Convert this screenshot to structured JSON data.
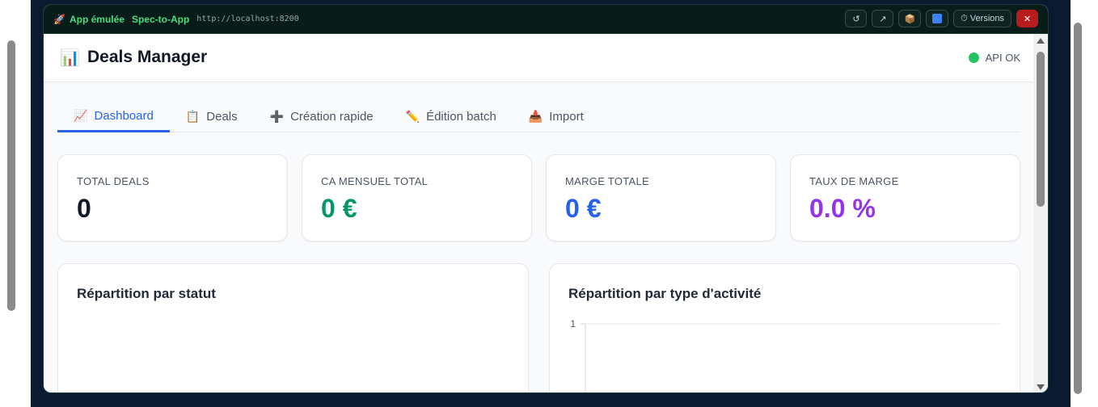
{
  "titlebar": {
    "rocket_icon": "rocket-icon",
    "app_label": "App émulée",
    "spec_label": "Spec-to-App",
    "url": "http://localhost:8200",
    "reload_glyph": "↺",
    "open_glyph": "↗",
    "package_glyph": "📦",
    "versions_label": "⏱ Versions",
    "close_glyph": "✕"
  },
  "header": {
    "icon": "📊",
    "title": "Deals Manager",
    "api_status": "API OK",
    "api_color": "#22c55e"
  },
  "tabs": [
    {
      "icon": "📈",
      "label": "Dashboard",
      "active": true
    },
    {
      "icon": "📋",
      "label": "Deals"
    },
    {
      "icon": "➕",
      "label": "Création rapide"
    },
    {
      "icon": "✏️",
      "label": "Édition batch"
    },
    {
      "icon": "📥",
      "label": "Import"
    }
  ],
  "stats": [
    {
      "label": "TOTAL DEALS",
      "value": "0",
      "color": "#111827"
    },
    {
      "label": "CA MENSUEL TOTAL",
      "value": "0 €",
      "color": "#059669"
    },
    {
      "label": "MARGE TOTALE",
      "value": "0 €",
      "color": "#2563eb"
    },
    {
      "label": "TAUX DE MARGE",
      "value": "0.0 %",
      "color": "#9333ea"
    }
  ],
  "panels": {
    "status_title": "Répartition par statut",
    "activity_title": "Répartition par type d'activité"
  },
  "chart_data": {
    "type": "bar",
    "title": "Répartition par type d'activité",
    "categories": [],
    "values": [],
    "ylim": [
      0,
      1
    ],
    "yticks": [
      "1"
    ],
    "grid": true
  },
  "colors": {
    "accent": "#2563eb",
    "title_green": "#4ade80",
    "close_red": "#b91c1c"
  }
}
